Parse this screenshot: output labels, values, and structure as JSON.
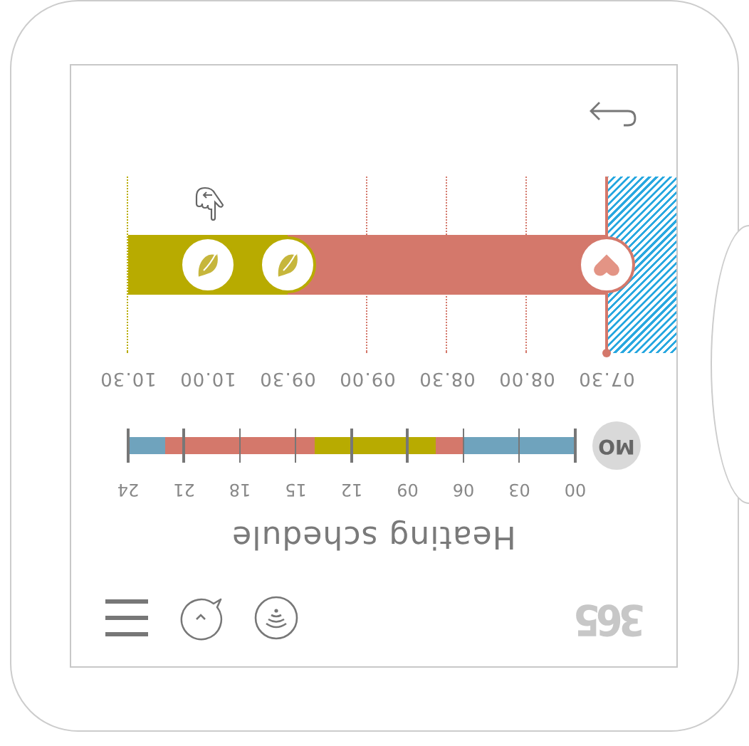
{
  "logo": "365",
  "title": "Heating schedule",
  "day": {
    "label": "MO",
    "hour_labels": [
      "00",
      "03",
      "06",
      "09",
      "12",
      "15",
      "18",
      "21",
      "24"
    ],
    "slots": [
      {
        "kind": "night"
      },
      {
        "kind": "night"
      },
      {
        "kind": "night"
      },
      {
        "kind": "night"
      },
      {
        "kind": "night"
      },
      {
        "kind": "night"
      },
      {
        "kind": "night"
      },
      {
        "kind": "night"
      },
      {
        "kind": "night"
      },
      {
        "kind": "night"
      },
      {
        "kind": "night"
      },
      {
        "kind": "night"
      },
      {
        "kind": "comfort"
      },
      {
        "kind": "comfort"
      },
      {
        "kind": "comfort"
      },
      {
        "kind": "eco"
      },
      {
        "kind": "eco"
      },
      {
        "kind": "eco"
      },
      {
        "kind": "eco"
      },
      {
        "kind": "eco"
      },
      {
        "kind": "eco"
      },
      {
        "kind": "eco"
      },
      {
        "kind": "eco"
      },
      {
        "kind": "eco"
      },
      {
        "kind": "eco"
      },
      {
        "kind": "eco"
      },
      {
        "kind": "eco"
      },
      {
        "kind": "eco"
      },
      {
        "kind": "comfort"
      },
      {
        "kind": "comfort"
      },
      {
        "kind": "comfort"
      },
      {
        "kind": "comfort"
      },
      {
        "kind": "comfort"
      },
      {
        "kind": "comfort"
      },
      {
        "kind": "comfort"
      },
      {
        "kind": "comfort"
      },
      {
        "kind": "comfort"
      },
      {
        "kind": "comfort"
      },
      {
        "kind": "comfort"
      },
      {
        "kind": "comfort"
      },
      {
        "kind": "comfort"
      },
      {
        "kind": "comfort"
      },
      {
        "kind": "comfort"
      },
      {
        "kind": "comfort"
      },
      {
        "kind": "night"
      },
      {
        "kind": "night"
      },
      {
        "kind": "night"
      },
      {
        "kind": "night"
      }
    ]
  },
  "timeline": {
    "times": [
      {
        "label": "07.30",
        "kind": "heart",
        "current": true
      },
      {
        "label": "08.00",
        "kind": "plain",
        "current": false
      },
      {
        "label": "08.30",
        "kind": "plain",
        "current": false
      },
      {
        "label": "09.00",
        "kind": "plain",
        "current": false
      },
      {
        "label": "09.30",
        "kind": "leaf",
        "current": false
      },
      {
        "label": "10.00",
        "kind": "leaf",
        "current": false
      },
      {
        "label": "10.30",
        "kind": "plain",
        "current": false
      }
    ],
    "slots": [
      {
        "kind": "comfort"
      },
      {
        "kind": "comfort"
      },
      {
        "kind": "comfort"
      },
      {
        "kind": "comfort"
      },
      {
        "kind": "eco"
      },
      {
        "kind": "eco"
      }
    ]
  }
}
